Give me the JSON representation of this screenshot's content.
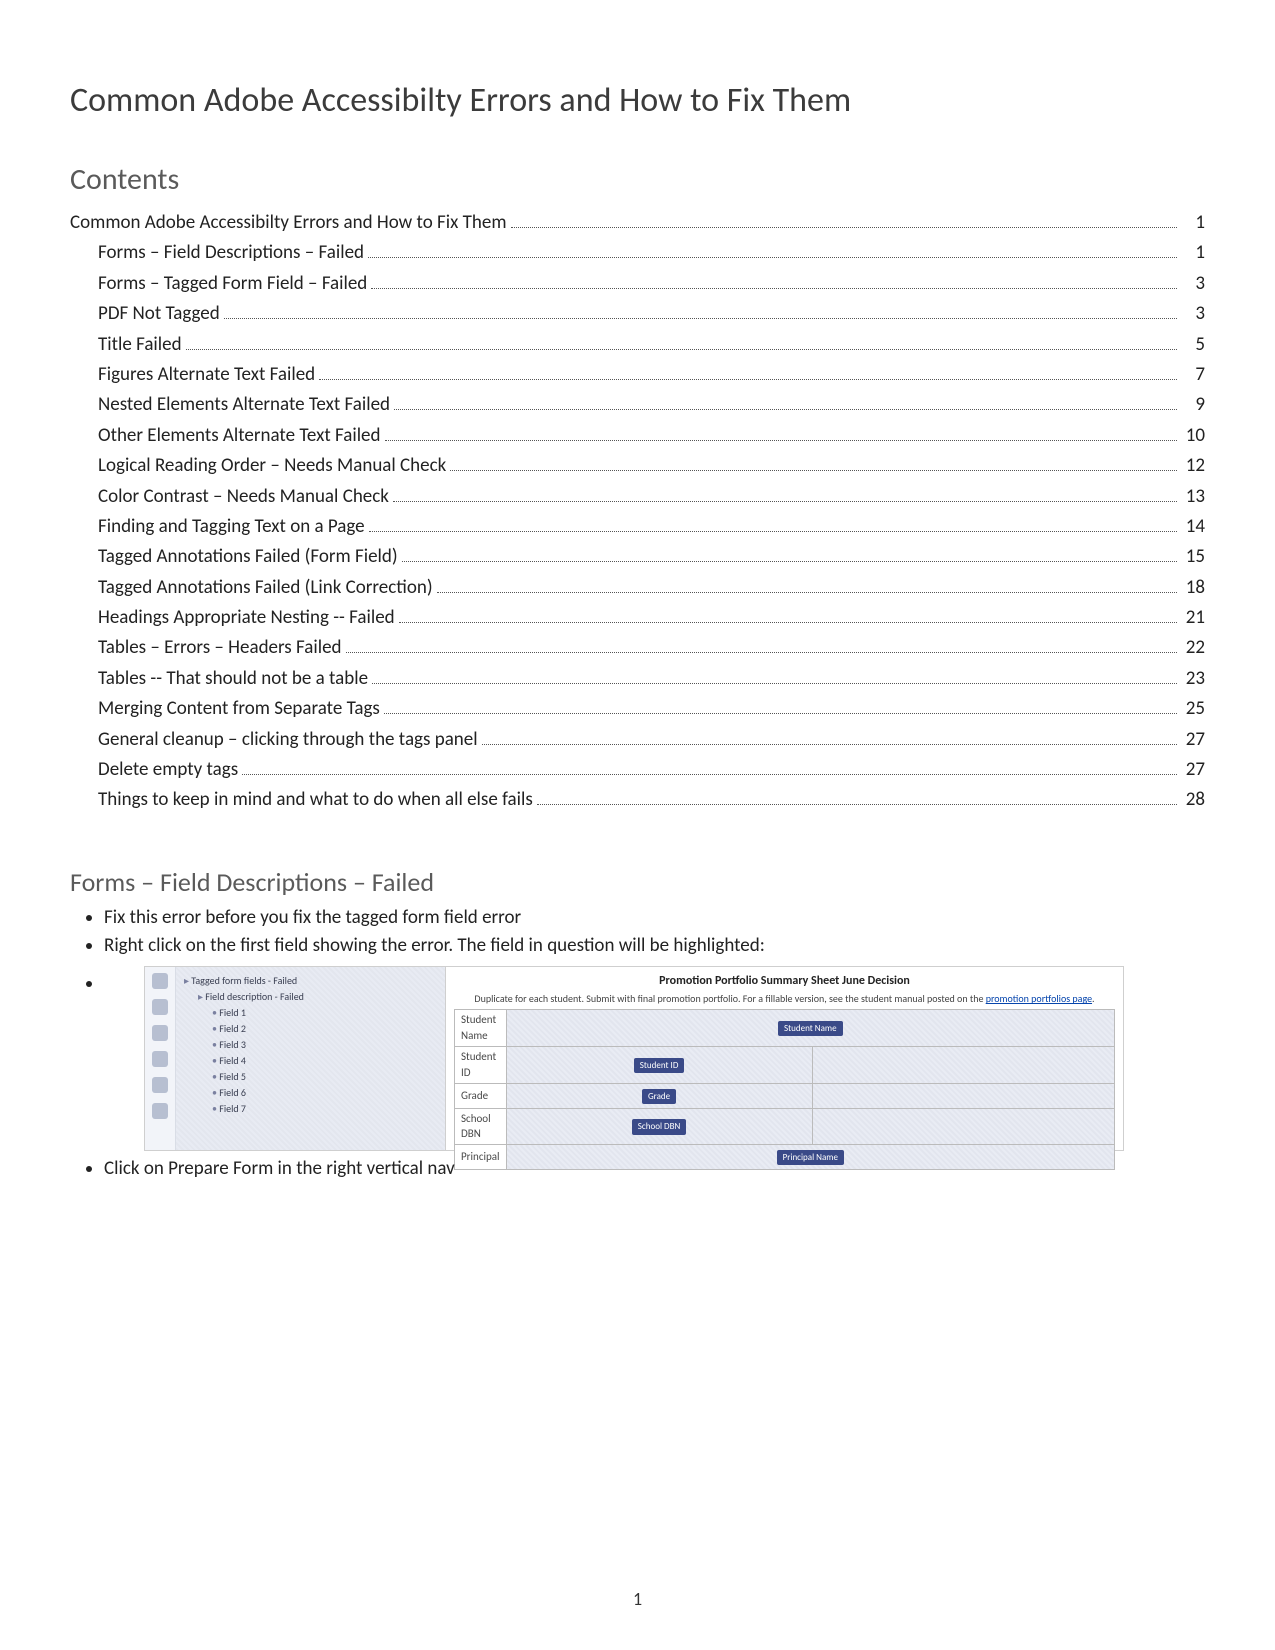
{
  "title": "Common Adobe Accessibilty Errors and How to Fix Them",
  "contents_heading": "Contents",
  "toc": [
    {
      "level": 0,
      "title": "Common Adobe Accessibilty Errors and How to Fix Them",
      "page": "1"
    },
    {
      "level": 1,
      "title": "Forms – Field Descriptions – Failed",
      "page": "1"
    },
    {
      "level": 1,
      "title": "Forms – Tagged Form Field – Failed",
      "page": "3"
    },
    {
      "level": 1,
      "title": "PDF Not Tagged",
      "page": "3"
    },
    {
      "level": 1,
      "title": "Title Failed",
      "page": "5"
    },
    {
      "level": 1,
      "title": "Figures Alternate Text Failed",
      "page": "7"
    },
    {
      "level": 1,
      "title": "Nested Elements Alternate Text Failed",
      "page": "9"
    },
    {
      "level": 1,
      "title": "Other Elements Alternate Text Failed",
      "page": "10"
    },
    {
      "level": 1,
      "title": "Logical Reading Order – Needs Manual Check",
      "page": "12"
    },
    {
      "level": 1,
      "title": "Color Contrast – Needs Manual Check",
      "page": "13"
    },
    {
      "level": 1,
      "title": "Finding and Tagging Text on a Page",
      "page": "14"
    },
    {
      "level": 1,
      "title": "Tagged Annotations Failed (Form Field)",
      "page": "15"
    },
    {
      "level": 1,
      "title": "Tagged Annotations Failed (Link Correction)",
      "page": "18"
    },
    {
      "level": 1,
      "title": "Headings Appropriate Nesting -- Failed",
      "page": "21"
    },
    {
      "level": 1,
      "title": "Tables – Errors – Headers Failed",
      "page": "22"
    },
    {
      "level": 1,
      "title": "Tables -- That should not be a table",
      "page": "23"
    },
    {
      "level": 1,
      "title": "Merging Content from Separate Tags",
      "page": "25"
    },
    {
      "level": 1,
      "title": "General cleanup – clicking through the tags panel",
      "page": "27"
    },
    {
      "level": 1,
      "title": "Delete empty tags",
      "page": "27"
    },
    {
      "level": 1,
      "title": "Things to keep in mind and what to do when all else fails",
      "page": "28"
    }
  ],
  "section_heading": "Forms – Field Descriptions – Failed",
  "bullets": {
    "b1": "Fix this error before you fix the tagged form field error",
    "b2": "Right click on the first field showing the error.  The field in question will be highlighted:",
    "b3": "Click on Prepare Form in the right vertical nav"
  },
  "screenshot": {
    "tree": {
      "n1": "Tagged form fields - Failed",
      "n2": "Field description - Failed",
      "f1": "Field 1",
      "f2": "Field 2",
      "f3": "Field 3",
      "f4": "Field 4",
      "f5": "Field 5",
      "f6": "Field 6",
      "f7": "Field 7"
    },
    "title": "Promotion Portfolio Summary Sheet June Decision",
    "sub_pre": "Duplicate for each student. Submit with final promotion portfolio. For a fillable version, see the student manual posted on the ",
    "sub_link": "promotion portfolios page",
    "sub_post": ".",
    "rows": {
      "student_name": "Student Name",
      "student_id": "Student ID",
      "grade": "Grade",
      "school_dbn": "School DBN",
      "principal": "Principal"
    },
    "chips": {
      "student_name": "Student Name",
      "student_id": "Student ID",
      "grade": "Grade",
      "school_dbn": "School DBN",
      "principal": "Principal Name"
    }
  },
  "page_number": "1"
}
